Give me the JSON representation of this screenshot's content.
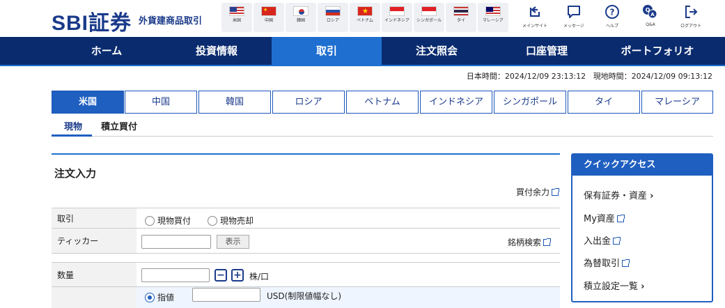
{
  "header": {
    "logo": "SBI証券",
    "logo_sub": "外貨建商品取引",
    "flags": [
      {
        "label": "米国",
        "icon": "us-flag-icon"
      },
      {
        "label": "中国",
        "icon": "cn-flag-icon"
      },
      {
        "label": "韓国",
        "icon": "kr-flag-icon"
      },
      {
        "label": "ロシア",
        "icon": "ru-flag-icon"
      },
      {
        "label": "ベトナム",
        "icon": "vn-flag-icon"
      },
      {
        "label": "インドネシア",
        "icon": "id-flag-icon"
      },
      {
        "label": "シンガポール",
        "icon": "sg-flag-icon"
      },
      {
        "label": "タイ",
        "icon": "th-flag-icon"
      },
      {
        "label": "マレーシア",
        "icon": "my-flag-icon"
      }
    ],
    "icons": [
      {
        "label": "メインサイト",
        "icon": "main-site-icon"
      },
      {
        "label": "メッセージ",
        "icon": "message-icon"
      },
      {
        "label": "ヘルプ",
        "icon": "help-icon"
      },
      {
        "label": "Q&A",
        "icon": "qa-icon"
      },
      {
        "label": "ログアウト",
        "icon": "logout-icon"
      }
    ]
  },
  "nav": {
    "items": [
      "ホーム",
      "投資情報",
      "取引",
      "注文照会",
      "口座管理",
      "ポートフォリオ"
    ],
    "active": "取引"
  },
  "times": {
    "japan": "日本時間：2024/12/09 23:13:12",
    "local": "現地時間：2024/12/09 09:13:12"
  },
  "country_tabs": [
    "米国",
    "中国",
    "韓国",
    "ロシア",
    "ベトナム",
    "インドネシア",
    "シンガポール",
    "タイ",
    "マレーシア"
  ],
  "sub_tabs": [
    "現物",
    "積立買付"
  ],
  "order": {
    "title": "注文入力",
    "buying_power": "買付余力",
    "trade_label": "取引",
    "trade_options": [
      "現物買付",
      "現物売却"
    ],
    "ticker_label": "ティッカー",
    "ticker_value": "",
    "show_button": "表示",
    "stock_search": "銘柄検索",
    "qty_label": "数量",
    "qty_value": "",
    "qty_unit": "株/口",
    "price_type": "指値",
    "price_value": "",
    "price_unit": "USD(制限値幅なし)"
  },
  "quick_access": {
    "title": "クイックアクセス",
    "items": [
      "保有証券・資産",
      "My資産",
      "入出金",
      "為替取引",
      "積立設定一覧"
    ]
  },
  "colors": {
    "nav_bg": "#0a2b6e",
    "accent": "#1f5fc0",
    "active_nav": "#1f6fd1"
  }
}
